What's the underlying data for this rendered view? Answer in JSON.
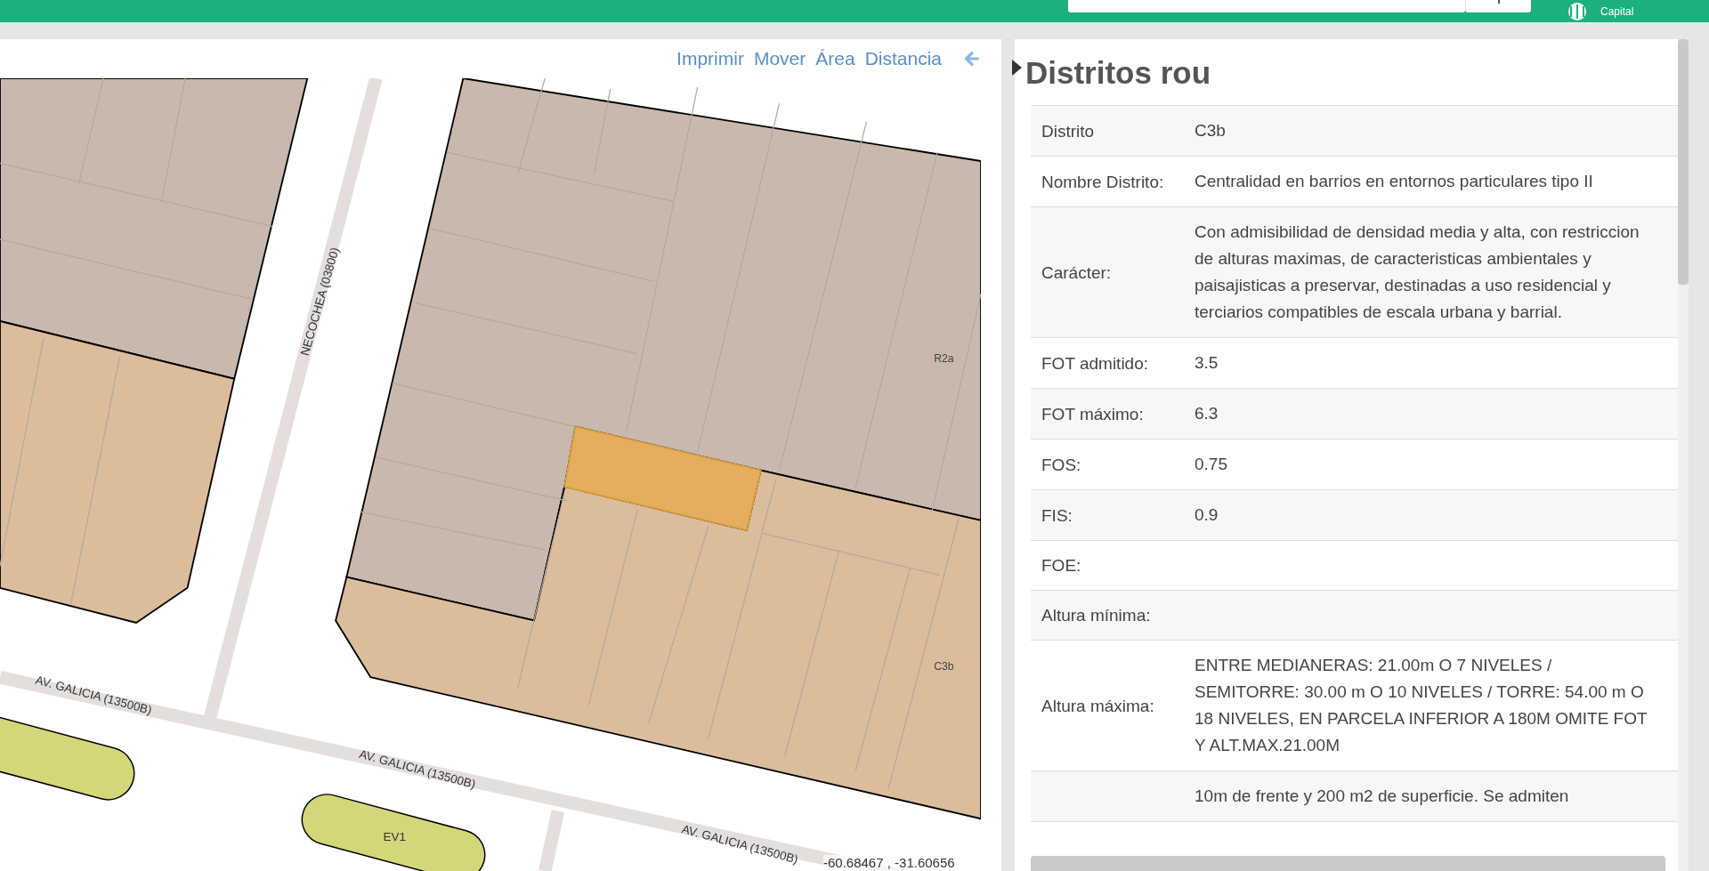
{
  "header": {
    "logo_text": "Capital"
  },
  "map_toolbar": {
    "tools": [
      {
        "label": "Imprimir"
      },
      {
        "label": "Mover"
      },
      {
        "label": "Área"
      },
      {
        "label": "Distancia"
      }
    ]
  },
  "map": {
    "street_labels": [
      "NECOCHEA (03800)",
      "AV. GALICIA (13500B)",
      "AV. GALICIA (13500B)",
      "AV. GALICIA (13500B)"
    ],
    "zone_labels": [
      "R2a",
      "C3b"
    ],
    "green_space_label": "EV1",
    "coordinates": "-60.68467 , -31.60656"
  },
  "info_panel": {
    "title": "Distritos rou",
    "rows": [
      {
        "label": "Distrito",
        "value": "C3b"
      },
      {
        "label": "Nombre Distrito:",
        "value": "Centralidad en barrios en entornos particulares tipo II"
      },
      {
        "label": "Carácter:",
        "value": "Con admisibilidad de densidad media y alta, con restriccion de alturas maximas, de caracteristicas ambientales y paisajisticas a preservar, destinadas a uso residencial y terciarios compatibles de escala urbana y barrial."
      },
      {
        "label": "FOT admitido:",
        "value": "3.5"
      },
      {
        "label": "FOT máximo:",
        "value": "6.3"
      },
      {
        "label": "FOS:",
        "value": "0.75"
      },
      {
        "label": "FIS:",
        "value": "0.9"
      },
      {
        "label": "FOE:"
      },
      {
        "label": "Altura mínima:"
      },
      {
        "label": "Altura máxima:",
        "value": "ENTRE MEDIANERAS: 21.00m O 7 NIVELES / SEMITORRE: 30.00 m O 10 NIVELES / TORRE: 54.00 m O 18 NIVELES, EN PARCELA INFERIOR A 180M OMITE FOT Y ALT.MAX.21.00M"
      },
      {
        "value": "10m de frente y 200 m2 de superficie. Se admiten"
      }
    ]
  }
}
